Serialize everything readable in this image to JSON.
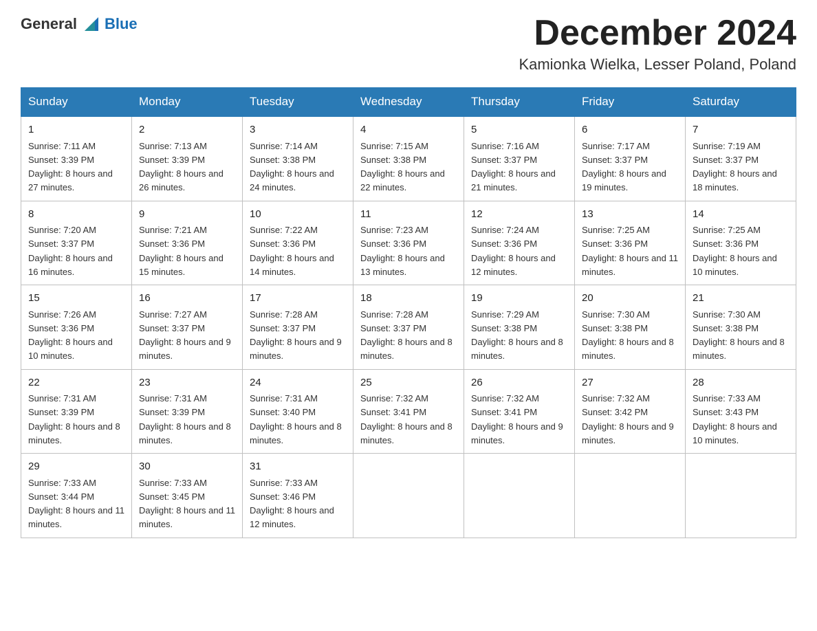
{
  "header": {
    "logo_general": "General",
    "logo_blue": "Blue",
    "month_title": "December 2024",
    "subtitle": "Kamionka Wielka, Lesser Poland, Poland"
  },
  "days_of_week": [
    "Sunday",
    "Monday",
    "Tuesday",
    "Wednesday",
    "Thursday",
    "Friday",
    "Saturday"
  ],
  "weeks": [
    [
      {
        "day": "1",
        "sunrise": "7:11 AM",
        "sunset": "3:39 PM",
        "daylight": "8 hours and 27 minutes."
      },
      {
        "day": "2",
        "sunrise": "7:13 AM",
        "sunset": "3:39 PM",
        "daylight": "8 hours and 26 minutes."
      },
      {
        "day": "3",
        "sunrise": "7:14 AM",
        "sunset": "3:38 PM",
        "daylight": "8 hours and 24 minutes."
      },
      {
        "day": "4",
        "sunrise": "7:15 AM",
        "sunset": "3:38 PM",
        "daylight": "8 hours and 22 minutes."
      },
      {
        "day": "5",
        "sunrise": "7:16 AM",
        "sunset": "3:37 PM",
        "daylight": "8 hours and 21 minutes."
      },
      {
        "day": "6",
        "sunrise": "7:17 AM",
        "sunset": "3:37 PM",
        "daylight": "8 hours and 19 minutes."
      },
      {
        "day": "7",
        "sunrise": "7:19 AM",
        "sunset": "3:37 PM",
        "daylight": "8 hours and 18 minutes."
      }
    ],
    [
      {
        "day": "8",
        "sunrise": "7:20 AM",
        "sunset": "3:37 PM",
        "daylight": "8 hours and 16 minutes."
      },
      {
        "day": "9",
        "sunrise": "7:21 AM",
        "sunset": "3:36 PM",
        "daylight": "8 hours and 15 minutes."
      },
      {
        "day": "10",
        "sunrise": "7:22 AM",
        "sunset": "3:36 PM",
        "daylight": "8 hours and 14 minutes."
      },
      {
        "day": "11",
        "sunrise": "7:23 AM",
        "sunset": "3:36 PM",
        "daylight": "8 hours and 13 minutes."
      },
      {
        "day": "12",
        "sunrise": "7:24 AM",
        "sunset": "3:36 PM",
        "daylight": "8 hours and 12 minutes."
      },
      {
        "day": "13",
        "sunrise": "7:25 AM",
        "sunset": "3:36 PM",
        "daylight": "8 hours and 11 minutes."
      },
      {
        "day": "14",
        "sunrise": "7:25 AM",
        "sunset": "3:36 PM",
        "daylight": "8 hours and 10 minutes."
      }
    ],
    [
      {
        "day": "15",
        "sunrise": "7:26 AM",
        "sunset": "3:36 PM",
        "daylight": "8 hours and 10 minutes."
      },
      {
        "day": "16",
        "sunrise": "7:27 AM",
        "sunset": "3:37 PM",
        "daylight": "8 hours and 9 minutes."
      },
      {
        "day": "17",
        "sunrise": "7:28 AM",
        "sunset": "3:37 PM",
        "daylight": "8 hours and 9 minutes."
      },
      {
        "day": "18",
        "sunrise": "7:28 AM",
        "sunset": "3:37 PM",
        "daylight": "8 hours and 8 minutes."
      },
      {
        "day": "19",
        "sunrise": "7:29 AM",
        "sunset": "3:38 PM",
        "daylight": "8 hours and 8 minutes."
      },
      {
        "day": "20",
        "sunrise": "7:30 AM",
        "sunset": "3:38 PM",
        "daylight": "8 hours and 8 minutes."
      },
      {
        "day": "21",
        "sunrise": "7:30 AM",
        "sunset": "3:38 PM",
        "daylight": "8 hours and 8 minutes."
      }
    ],
    [
      {
        "day": "22",
        "sunrise": "7:31 AM",
        "sunset": "3:39 PM",
        "daylight": "8 hours and 8 minutes."
      },
      {
        "day": "23",
        "sunrise": "7:31 AM",
        "sunset": "3:39 PM",
        "daylight": "8 hours and 8 minutes."
      },
      {
        "day": "24",
        "sunrise": "7:31 AM",
        "sunset": "3:40 PM",
        "daylight": "8 hours and 8 minutes."
      },
      {
        "day": "25",
        "sunrise": "7:32 AM",
        "sunset": "3:41 PM",
        "daylight": "8 hours and 8 minutes."
      },
      {
        "day": "26",
        "sunrise": "7:32 AM",
        "sunset": "3:41 PM",
        "daylight": "8 hours and 9 minutes."
      },
      {
        "day": "27",
        "sunrise": "7:32 AM",
        "sunset": "3:42 PM",
        "daylight": "8 hours and 9 minutes."
      },
      {
        "day": "28",
        "sunrise": "7:33 AM",
        "sunset": "3:43 PM",
        "daylight": "8 hours and 10 minutes."
      }
    ],
    [
      {
        "day": "29",
        "sunrise": "7:33 AM",
        "sunset": "3:44 PM",
        "daylight": "8 hours and 11 minutes."
      },
      {
        "day": "30",
        "sunrise": "7:33 AM",
        "sunset": "3:45 PM",
        "daylight": "8 hours and 11 minutes."
      },
      {
        "day": "31",
        "sunrise": "7:33 AM",
        "sunset": "3:46 PM",
        "daylight": "8 hours and 12 minutes."
      },
      null,
      null,
      null,
      null
    ]
  ]
}
